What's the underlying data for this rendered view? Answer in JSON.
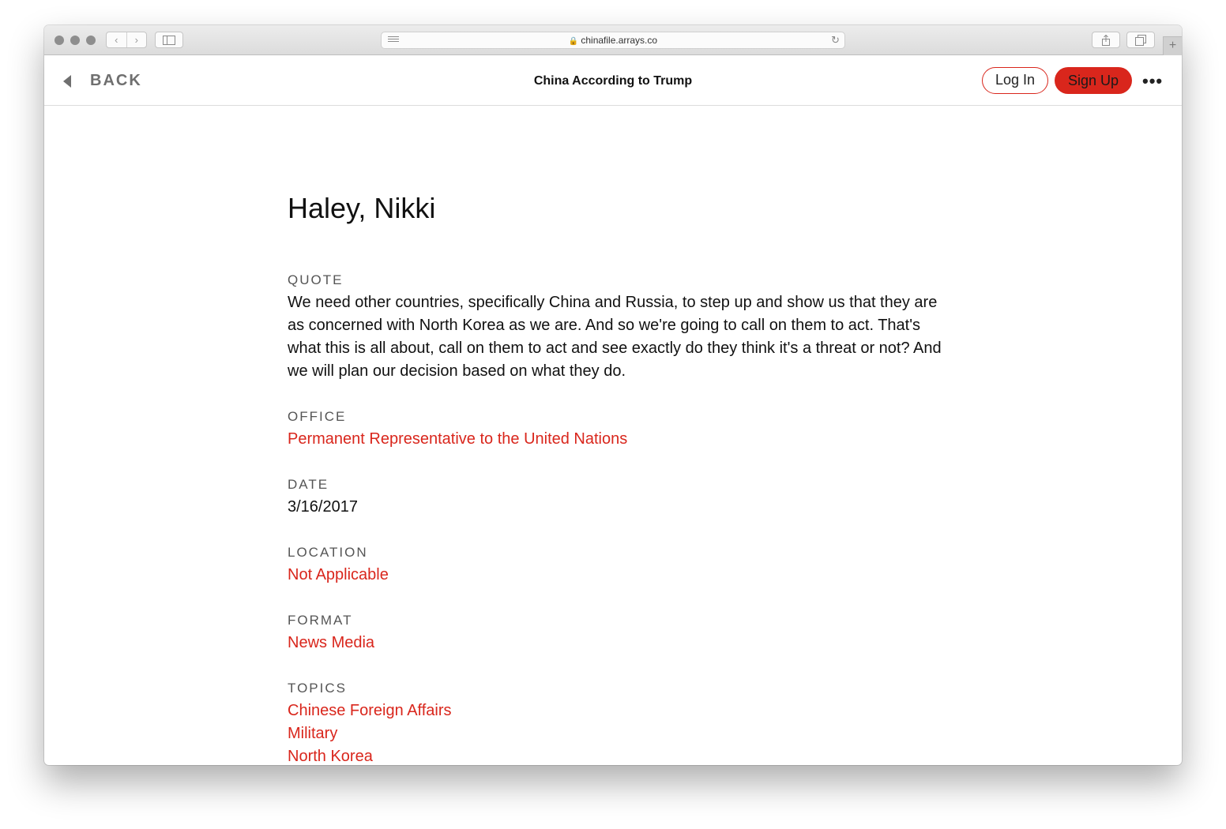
{
  "browser": {
    "url": "chinafile.arrays.co",
    "new_tab_symbol": "+"
  },
  "header": {
    "back_label": "BACK",
    "title": "China According to Trump",
    "login_label": "Log In",
    "signup_label": "Sign Up",
    "more_symbol": "•••"
  },
  "entry": {
    "name": "Haley, Nikki",
    "quote": {
      "label": "QUOTE",
      "text": "We need other countries, specifically China and Russia, to step up and show us that they are as concerned with North Korea as we are. And so we're going to call on them to act. That's what this is all about, call on them to act and see exactly do they think it's a threat or not? And we will plan our decision based on what they do."
    },
    "office": {
      "label": "OFFICE",
      "value": "Permanent Representative to the United Nations"
    },
    "date": {
      "label": "DATE",
      "value": "3/16/2017"
    },
    "location": {
      "label": "LOCATION",
      "value": "Not Applicable"
    },
    "format": {
      "label": "FORMAT",
      "value": "News Media"
    },
    "topics": {
      "label": "TOPICS",
      "items": [
        "Chinese Foreign Affairs",
        "Military",
        "North Korea"
      ]
    }
  },
  "colors": {
    "accent": "#d9261c",
    "label": "#555555",
    "text": "#111111"
  }
}
